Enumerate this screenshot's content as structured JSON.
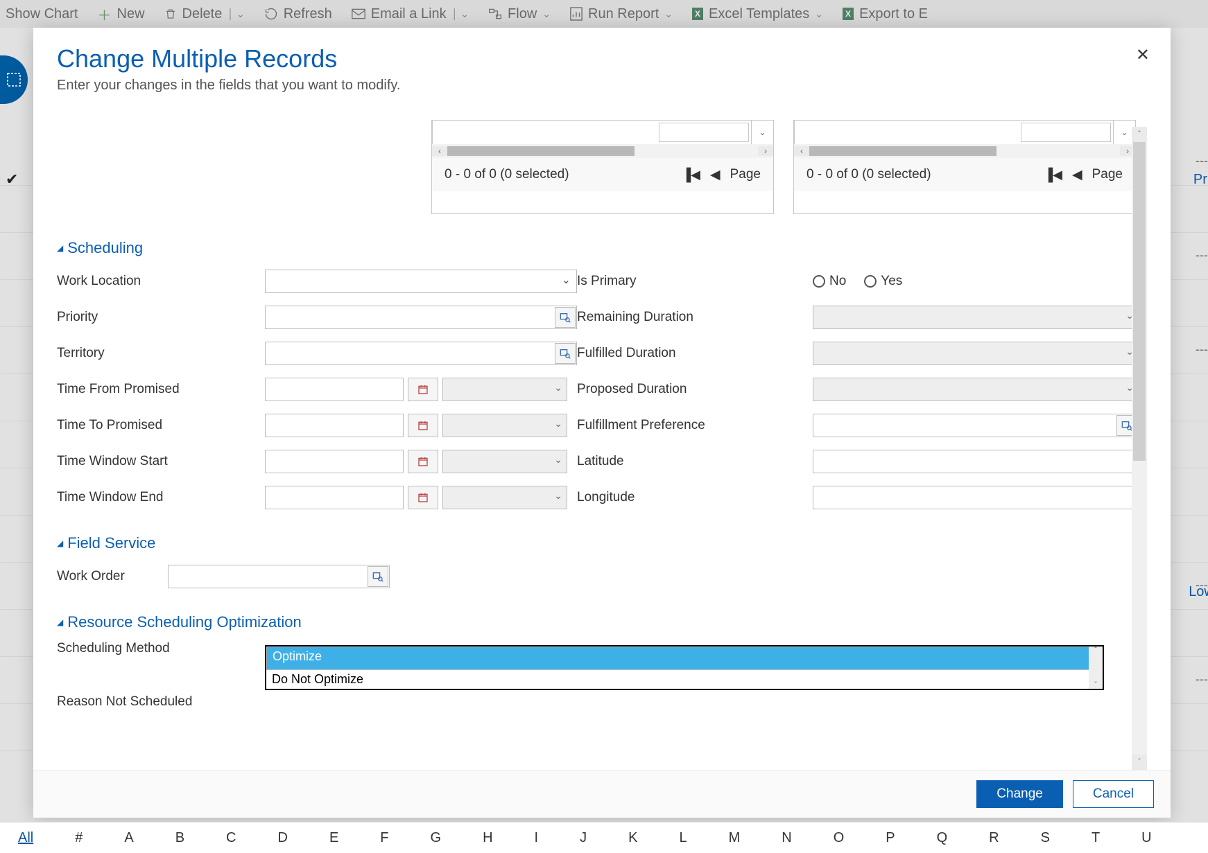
{
  "toolbar": {
    "show_chart": "Show Chart",
    "new": "New",
    "delete": "Delete",
    "refresh": "Refresh",
    "email_link": "Email a Link",
    "flow": "Flow",
    "run_report": "Run Report",
    "excel_templates": "Excel Templates",
    "export": "Export to E"
  },
  "side": {
    "prio": "Prio.",
    "lowl": "LowL",
    "dashes": "---"
  },
  "alpha": {
    "all": "All",
    "letters": [
      "#",
      "A",
      "B",
      "C",
      "D",
      "E",
      "F",
      "G",
      "H",
      "I",
      "J",
      "K",
      "L",
      "M",
      "N",
      "O",
      "P",
      "Q",
      "R",
      "S",
      "T",
      "U"
    ]
  },
  "dialog": {
    "title": "Change Multiple Records",
    "subtitle": "Enter your changes in the fields that you want to modify.",
    "close": "✕",
    "panel_status": "0 - 0 of 0 (0 selected)",
    "page_label": "Page",
    "sections": {
      "scheduling": "Scheduling",
      "field_service": "Field Service",
      "rso": "Resource Scheduling Optimization"
    },
    "labels": {
      "work_location": "Work Location",
      "priority": "Priority",
      "territory": "Territory",
      "time_from_promised": "Time From Promised",
      "time_to_promised": "Time To Promised",
      "time_window_start": "Time Window Start",
      "time_window_end": "Time Window End",
      "is_primary": "Is Primary",
      "remaining_duration": "Remaining Duration",
      "fulfilled_duration": "Fulfilled Duration",
      "proposed_duration": "Proposed Duration",
      "fulfillment_preference": "Fulfillment Preference",
      "latitude": "Latitude",
      "longitude": "Longitude",
      "work_order": "Work Order",
      "scheduling_method": "Scheduling Method",
      "reason_not_scheduled": "Reason Not Scheduled"
    },
    "radio": {
      "no": "No",
      "yes": "Yes"
    },
    "dd_options": {
      "optimize": "Optimize",
      "do_not_optimize": "Do Not Optimize"
    },
    "buttons": {
      "change": "Change",
      "cancel": "Cancel"
    }
  }
}
